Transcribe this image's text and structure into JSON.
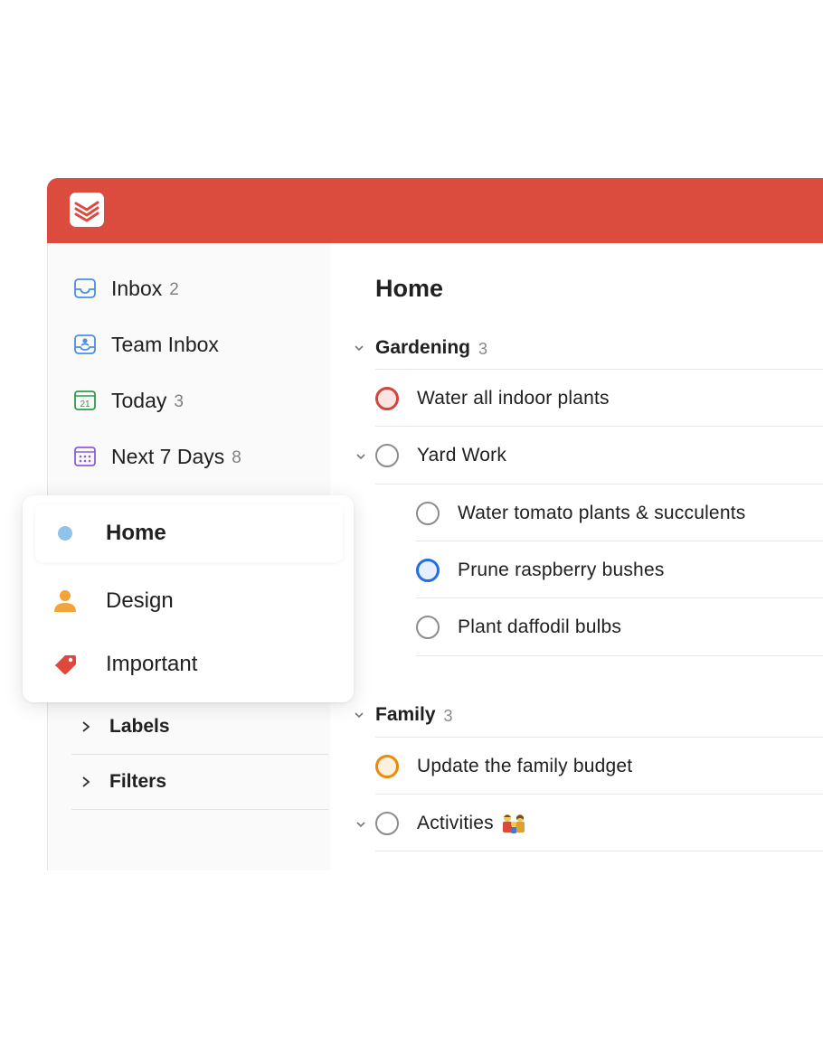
{
  "sidebar": {
    "items": [
      {
        "label": "Inbox",
        "count": "2",
        "icon": "inbox-icon"
      },
      {
        "label": "Team Inbox",
        "count": "",
        "icon": "team-inbox-icon"
      },
      {
        "label": "Today",
        "count": "3",
        "icon": "calendar-today-icon",
        "date": "21"
      },
      {
        "label": "Next 7 Days",
        "count": "8",
        "icon": "calendar-week-icon"
      }
    ],
    "collapsibles": [
      {
        "label": "Labels"
      },
      {
        "label": "Filters"
      }
    ]
  },
  "popup": {
    "items": [
      {
        "label": "Home",
        "icon": "project-dot-icon",
        "active": true
      },
      {
        "label": "Design",
        "icon": "person-icon"
      },
      {
        "label": "Important",
        "icon": "label-tag-icon"
      }
    ]
  },
  "main": {
    "title": "Home",
    "sections": [
      {
        "title": "Gardening",
        "count": "3",
        "tasks": [
          {
            "label": "Water all indoor plants",
            "priority": "p1"
          },
          {
            "label": "Yard Work",
            "priority": "none",
            "subtasks": [
              {
                "label": "Water tomato plants & succulents",
                "priority": "none"
              },
              {
                "label": "Prune raspberry bushes",
                "priority": "p3"
              },
              {
                "label": "Plant daffodil bulbs",
                "priority": "none"
              }
            ]
          }
        ]
      },
      {
        "title": "Family",
        "count": "3",
        "tasks": [
          {
            "label": "Update the family budget",
            "priority": "p2"
          },
          {
            "label": "Activities",
            "priority": "none",
            "emoji": "family-emoji"
          }
        ]
      }
    ]
  },
  "colors": {
    "brand": "#db4c3f",
    "p1": "#d1453b",
    "p2": "#eb8909",
    "p3": "#246fe0",
    "home_dot": "#8fc3ea",
    "person": "#f2a33a",
    "tag": "#e0473d"
  }
}
